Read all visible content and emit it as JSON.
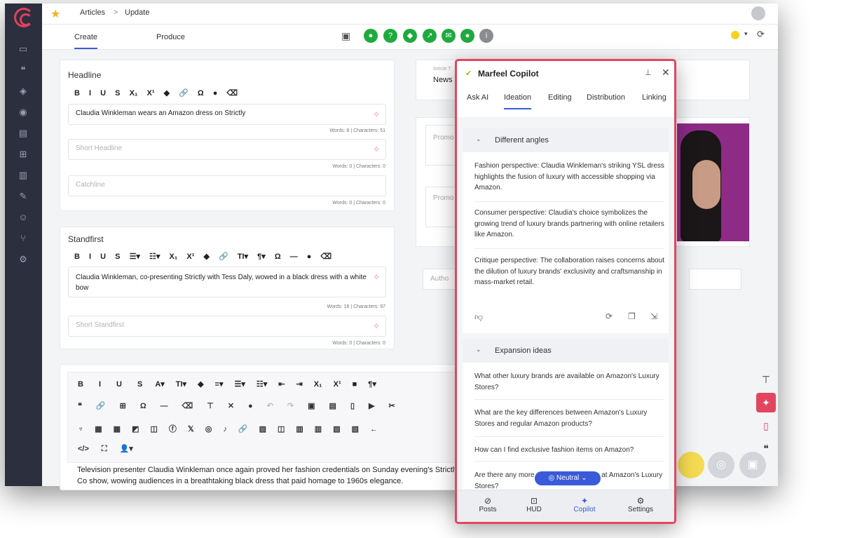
{
  "breadcrumb": {
    "root": "Articles",
    "separator": ">",
    "current": "Update"
  },
  "tabs": [
    {
      "label": "Create",
      "active": true
    },
    {
      "label": "Produce",
      "active": false
    }
  ],
  "headline_card": {
    "label": "Headline",
    "toolbar": [
      "B",
      "I",
      "U",
      "S",
      "X₁",
      "X¹",
      "◆",
      "🔗",
      "Ω",
      "●",
      "⌫"
    ],
    "headline_value": "Claudia Winkleman wears an Amazon dress on Strictly",
    "headline_count": "Words: 8 | Characters: 51",
    "short_headline_placeholder": "Short Headline",
    "short_headline_count": "Words: 0 | Characters: 0",
    "catchline_placeholder": "Catchline",
    "catchline_count": "Words: 0 | Characters: 0"
  },
  "standfirst_card": {
    "label": "Standfirst",
    "toolbar": [
      "B",
      "I",
      "U",
      "S",
      "☰▾",
      "☷▾",
      "X₁",
      "X¹",
      "◆",
      "🔗",
      "TI▾",
      "¶▾",
      "Ω",
      "—",
      "●",
      "⌫"
    ],
    "value": "Claudia Winkleman, co-presenting Strictly with Tess Daly, wowed in a black dress with a white bow",
    "count": "Words: 16 | Characters: 97",
    "short_placeholder": "Short Standfirst",
    "short_count": "Words: 0 | Characters: 0"
  },
  "body_editor": {
    "toolbar_row1": [
      "B",
      "I",
      "U",
      "S",
      "A▾",
      "TI▾",
      "◆",
      "≡▾",
      "☰▾",
      "☷▾",
      "⇤",
      "⇥",
      "X₁",
      "X¹",
      "■",
      "¶▾"
    ],
    "toolbar_row2": [
      "❝",
      "🔗",
      "⊞",
      "Ω",
      "—",
      "⌫",
      "⊤",
      "✕",
      "●",
      "↶",
      "↷",
      "▣",
      "▤",
      "▯",
      "▶",
      "✂"
    ],
    "toolbar_row3": [
      "♆",
      "▦",
      "▦",
      "◩",
      "◫",
      "ⓕ",
      "𝕏",
      "◎",
      "♪",
      "🔗",
      "▨",
      "◫",
      "▥",
      "▥",
      "▧",
      "▧",
      "←"
    ],
    "toolbar_row4": [
      "</>",
      "⛶",
      "👤▾"
    ],
    "text": "Television presenter Claudia Winkleman once again proved her fashion credentials on Sunday evening's Strictly Co show, wowing audiences in a breathtaking black dress that paid homage to 1960s elegance."
  },
  "right_panel": {
    "article_type_label": "Article T",
    "article_type_value": "News",
    "promo1": "Promo",
    "promo2": "Promo",
    "author": "Autho"
  },
  "copilot": {
    "title": "Marfeel Copilot",
    "tabs": [
      "Ask AI",
      "Ideation",
      "Editing",
      "Distribution",
      "Linking"
    ],
    "active_tab": "Ideation",
    "sections": [
      {
        "title": "Different angles",
        "items": [
          "Fashion perspective: Claudia Winkleman's striking YSL dress highlights the fusion of luxury with accessible shopping via Amazon.",
          "Consumer perspective: Claudia's choice symbolizes the growing trend of luxury brands partnering with online retailers like Amazon.",
          "Critique perspective: The collaboration raises concerns about the dilution of luxury brands' exclusivity and craftsmanship in mass-market retail."
        ]
      },
      {
        "title": "Expansion ideas",
        "items": [
          "What other luxury brands are available on Amazon's Luxury Stores?",
          "What are the key differences between Amazon's Luxury Stores and regular Amazon products?",
          "How can I find exclusive fashion items on Amazon?",
          "Are there any more experiments to shop at Amazon's Luxury Stores?"
        ]
      }
    ],
    "tone": "Neutral",
    "bottom_nav": [
      {
        "label": "Posts",
        "icon": "compass-icon"
      },
      {
        "label": "HUD",
        "icon": "hud-icon"
      },
      {
        "label": "Copilot",
        "icon": "sparkle-icon",
        "active": true
      },
      {
        "label": "Settings",
        "icon": "gear-icon"
      }
    ]
  },
  "colors": {
    "accent": "#3a5bd9",
    "brand": "#e2465f",
    "sidebar": "#2b2f3e",
    "status_green": "#1faa3e"
  }
}
